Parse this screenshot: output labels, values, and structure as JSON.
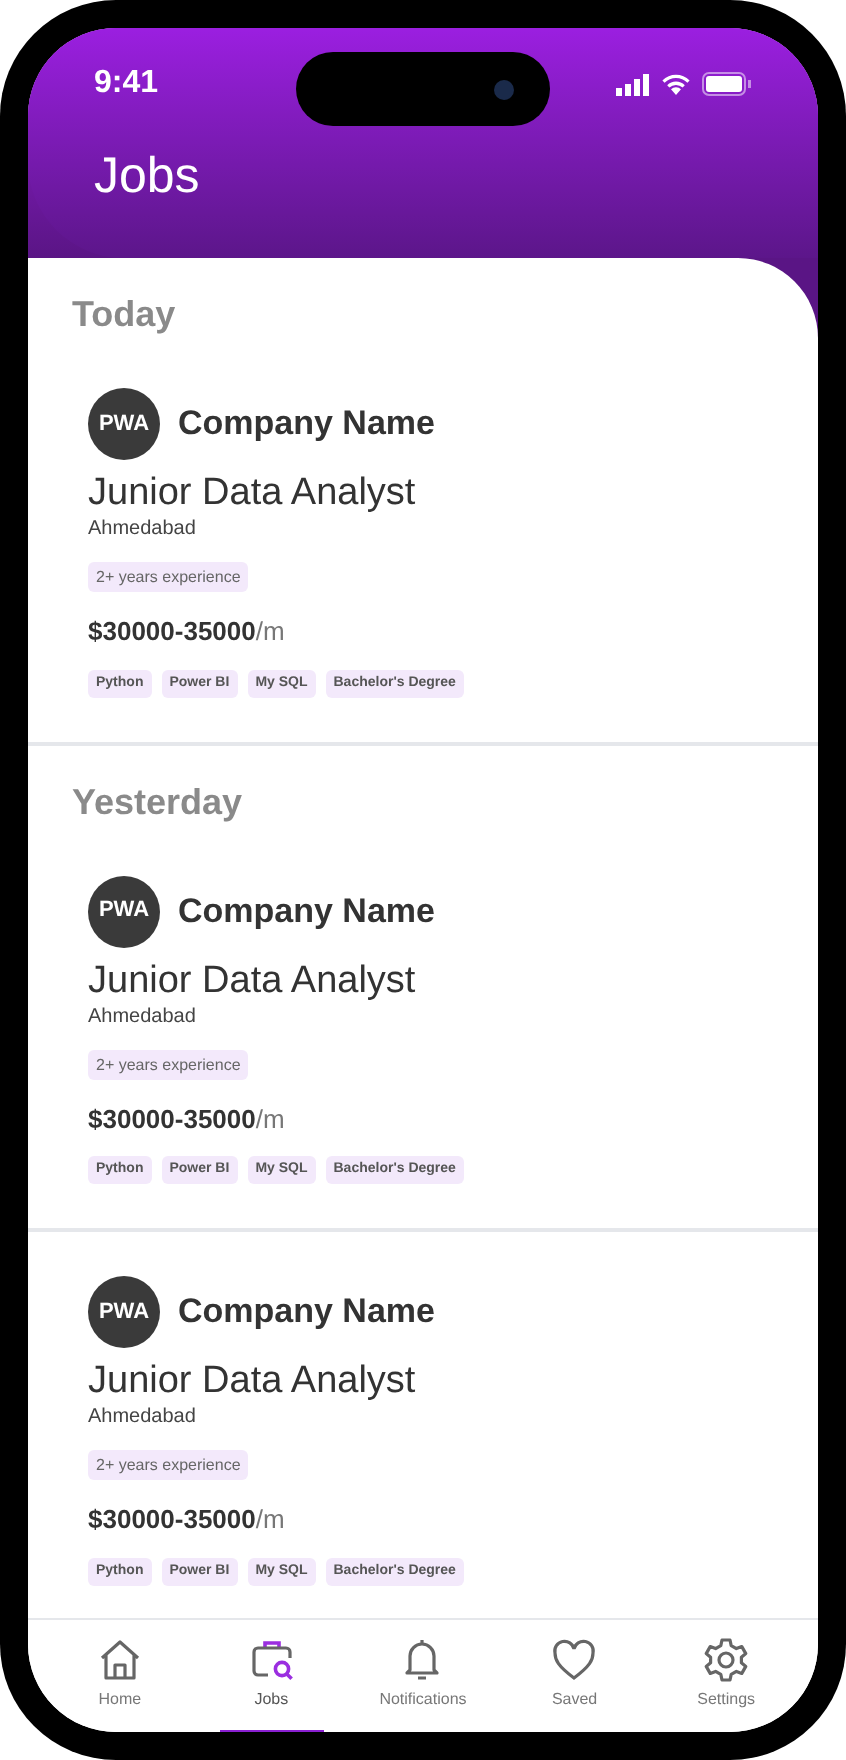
{
  "status_bar": {
    "time": "9:41"
  },
  "header": {
    "title": "Jobs"
  },
  "sections": [
    {
      "title": "Today",
      "jobs": [
        {
          "logo": "PWA",
          "company": "Company Name",
          "title": "Junior Data Analyst",
          "location": "Ahmedabad",
          "experience": "2+ years experience",
          "salary": "$30000-35000",
          "period": "/m",
          "skills": [
            "Python",
            "Power BI",
            "My SQL",
            "Bachelor's Degree"
          ]
        }
      ]
    },
    {
      "title": "Yesterday",
      "jobs": [
        {
          "logo": "PWA",
          "company": "Company Name",
          "title": "Junior Data Analyst",
          "location": "Ahmedabad",
          "experience": "2+ years experience",
          "salary": "$30000-35000",
          "period": "/m",
          "skills": [
            "Python",
            "Power BI",
            "My SQL",
            "Bachelor's Degree"
          ]
        },
        {
          "logo": "PWA",
          "company": "Company Name",
          "title": "Junior Data Analyst",
          "location": "Ahmedabad",
          "experience": "2+ years experience",
          "salary": "$30000-35000",
          "period": "/m",
          "skills": [
            "Python",
            "Power BI",
            "My SQL",
            "Bachelor's Degree"
          ]
        }
      ]
    }
  ],
  "tab_bar": [
    {
      "kind": "home",
      "label": "Home",
      "selected": false
    },
    {
      "kind": "jobs",
      "label": "Jobs",
      "selected": true
    },
    {
      "kind": "notifications",
      "label": "Notifications",
      "selected": false
    },
    {
      "kind": "saved",
      "label": "Saved",
      "selected": false
    },
    {
      "kind": "settings",
      "label": "Settings",
      "selected": false
    }
  ]
}
